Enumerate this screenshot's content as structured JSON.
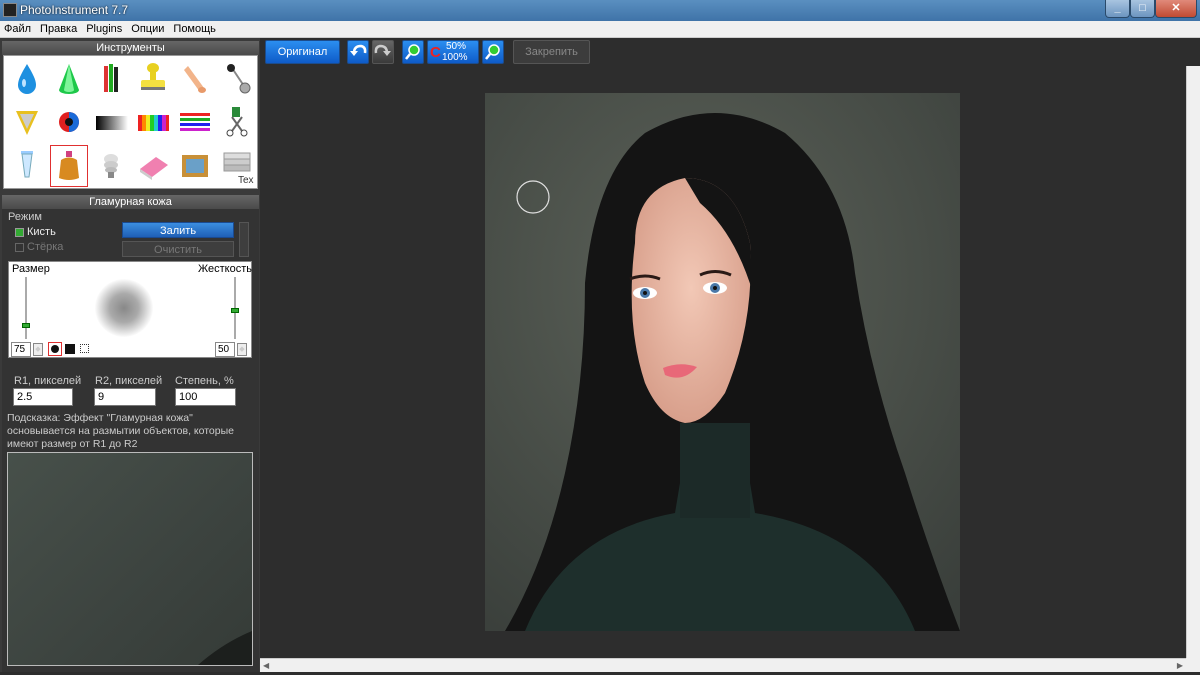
{
  "window": {
    "title": "PhotoInstrument 7.7",
    "minimize": "_",
    "maximize": "□",
    "close": "✕"
  },
  "menu": [
    "Файл",
    "Правка",
    "Plugins",
    "Опции",
    "Помощь"
  ],
  "tools_panel": {
    "title": "Инструменты",
    "tools": [
      {
        "name": "drop-tool-icon"
      },
      {
        "name": "cone-tool-icon"
      },
      {
        "name": "pencils-tool-icon"
      },
      {
        "name": "stamp-tool-icon"
      },
      {
        "name": "finger-tool-icon"
      },
      {
        "name": "pin-tool-icon"
      },
      {
        "name": "amulet-tool-icon"
      },
      {
        "name": "red-eye-tool-icon"
      },
      {
        "name": "gradient-tool-icon"
      },
      {
        "name": "color-bars-tool-icon"
      },
      {
        "name": "lines-tool-icon"
      },
      {
        "name": "scissors-tool-icon"
      },
      {
        "name": "tube-tool-icon"
      },
      {
        "name": "perfume-tool-icon",
        "selected": true
      },
      {
        "name": "bulb-tool-icon"
      },
      {
        "name": "eraser-tool-icon"
      },
      {
        "name": "frame-tool-icon"
      },
      {
        "name": "text-tool-icon"
      }
    ],
    "text_tool_label": "Tex"
  },
  "settings": {
    "title": "Гламурная кожа",
    "mode_label": "Режим",
    "brush_label": "Кисть",
    "eraser_label": "Стёрка",
    "fill_button": "Залить",
    "clear_button": "Очистить",
    "size_label": "Размер",
    "hardness_label": "Жесткость",
    "size_value": "75",
    "hardness_value": "50",
    "size_level": 0.75,
    "hardness_level": 0.5,
    "r1_label": "R1, пикселей",
    "r2_label": "R2, пикселей",
    "degree_label": "Степень, %",
    "r1_value": "2.5",
    "r2_value": "9",
    "degree_value": "100",
    "hint": "Подсказка: Эффект \"Гламурная кожа\" основывается на размытии объектов, которые имеют размер от R1 до R2"
  },
  "toolbar": {
    "original_button": "Оригинал",
    "undo": "undo-icon",
    "redo": "redo-icon",
    "zoom_in": "zoom-in-icon",
    "zoom_toggle_top": "50%",
    "zoom_toggle_bottom": "100%",
    "zoom_out": "zoom-out-icon",
    "fix_button": "Закрепить"
  },
  "colors": {
    "accent": "#1f6fd8",
    "selection": "#e03030",
    "panel_bg": "#333333"
  }
}
